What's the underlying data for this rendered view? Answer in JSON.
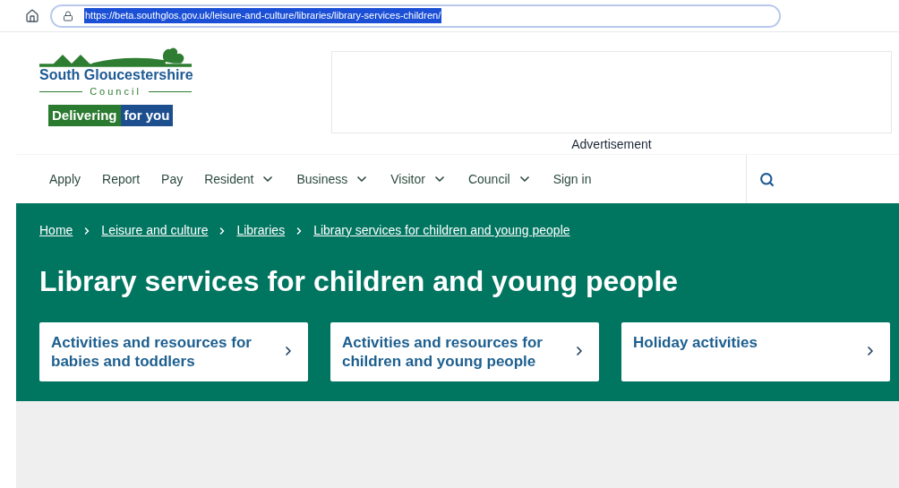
{
  "browser": {
    "url": "https://beta.southglos.gov.uk/leisure-and-culture/libraries/library-services-children/"
  },
  "logo": {
    "name": "South Gloucestershire",
    "subtitle": "Council",
    "tagline_part_1": "Delivering",
    "tagline_part_2": "for you"
  },
  "advert": {
    "label": "Advertisement"
  },
  "nav": [
    {
      "label": "Apply",
      "dropdown": false
    },
    {
      "label": "Report",
      "dropdown": false
    },
    {
      "label": "Pay",
      "dropdown": false
    },
    {
      "label": "Resident",
      "dropdown": true
    },
    {
      "label": "Business",
      "dropdown": true
    },
    {
      "label": "Visitor",
      "dropdown": true
    },
    {
      "label": "Council",
      "dropdown": true
    },
    {
      "label": "Sign in",
      "dropdown": false
    }
  ],
  "breadcrumbs": [
    "Home",
    "Leisure and culture",
    "Libraries",
    "Library services for children and young people"
  ],
  "page_title": "Library services for children and young people",
  "cards": [
    "Activities and resources for babies and toddlers",
    "Activities and resources for children and young people",
    "Holiday activities"
  ]
}
